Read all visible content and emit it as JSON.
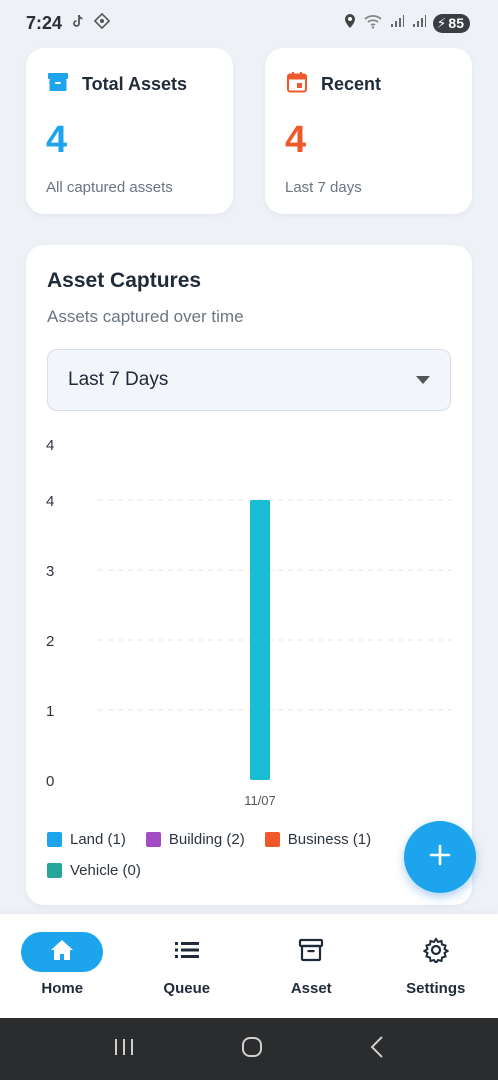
{
  "status_bar": {
    "time": "7:24",
    "battery": "85"
  },
  "summary": {
    "total": {
      "title": "Total Assets",
      "value": "4",
      "caption": "All captured assets"
    },
    "recent": {
      "title": "Recent",
      "value": "4",
      "caption": "Last 7 days"
    }
  },
  "captures": {
    "title": "Asset Captures",
    "subtitle": "Assets captured over time",
    "range_selected": "Last 7 Days",
    "y_tick_labels": [
      "0",
      "1",
      "2",
      "3",
      "4",
      "4"
    ],
    "legend": [
      {
        "label": "Land (1)",
        "color": "#1ca5ec"
      },
      {
        "label": "Building (2)",
        "color": "#a54cc4"
      },
      {
        "label": "Business (1)",
        "color": "#f0582a"
      },
      {
        "label": "Vehicle (0)",
        "color": "#26a69a"
      }
    ]
  },
  "chart_data": {
    "type": "bar",
    "categories": [
      "11/07"
    ],
    "values": [
      4
    ],
    "ylim": [
      0,
      4
    ],
    "bar_color": "#18bdd4",
    "grid": true
  },
  "nav": {
    "items": [
      {
        "label": "Home",
        "icon": "home-icon",
        "active": true
      },
      {
        "label": "Queue",
        "icon": "list-icon",
        "active": false
      },
      {
        "label": "Asset",
        "icon": "archive-icon",
        "active": false
      },
      {
        "label": "Settings",
        "icon": "gear-icon",
        "active": false
      }
    ]
  },
  "colors": {
    "accent": "#1ca5ec",
    "recent": "#f0582a"
  }
}
